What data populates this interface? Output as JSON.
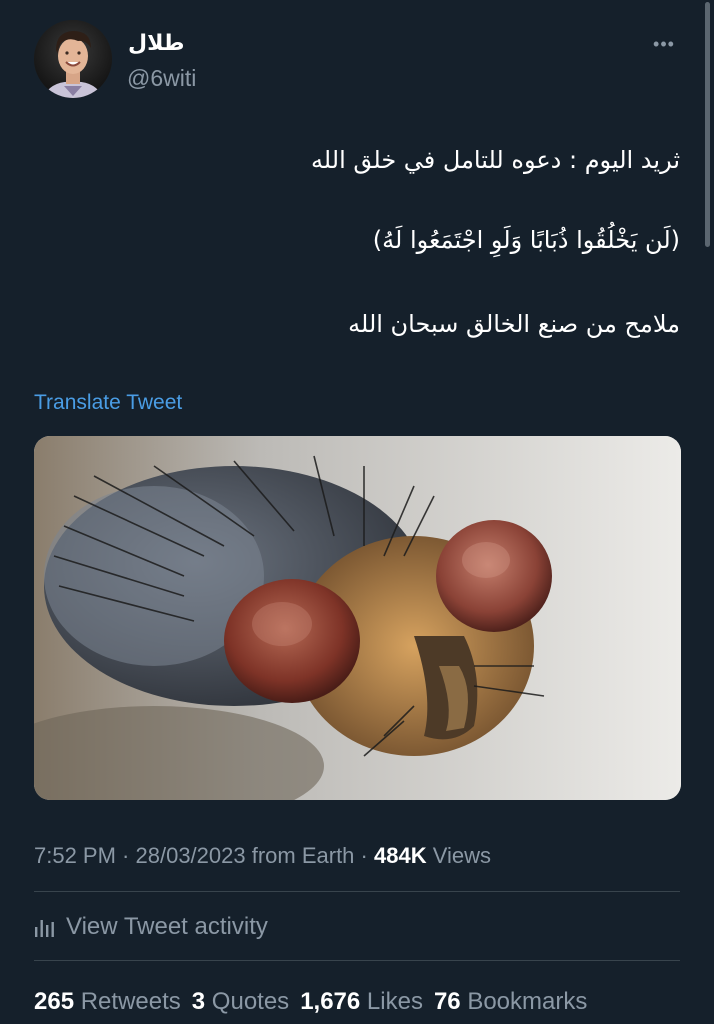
{
  "author": {
    "display_name": "طلال",
    "handle": "@6witi"
  },
  "header": {
    "more_label": "•••"
  },
  "tweet": {
    "lines": [
      "ثريد اليوم : دعوه للتامل في خلق الله",
      "(لَن يَخْلُقُوا ذُبَابًا وَلَوِ اجْتَمَعُوا لَهُ)",
      "ملامح من صنع الخالق سبحان الله"
    ],
    "translate_label": "Translate Tweet"
  },
  "meta": {
    "time": "7:52 PM",
    "sep1": " · ",
    "date": "28/03/2023",
    "source": " from Earth",
    "sep2": " · ",
    "views_count": "484K",
    "views_label": " Views"
  },
  "activity": {
    "label": "View Tweet activity"
  },
  "stats": {
    "retweets_count": "265",
    "retweets_label": "Retweets",
    "quotes_count": "3",
    "quotes_label": "Quotes",
    "likes_count": "1,676",
    "likes_label": "Likes",
    "bookmarks_count": "76",
    "bookmarks_label": "Bookmarks"
  },
  "colors": {
    "background": "#15202b",
    "accent": "#4a9de5",
    "secondary_text": "#8b98a5",
    "divider": "#38444d"
  }
}
